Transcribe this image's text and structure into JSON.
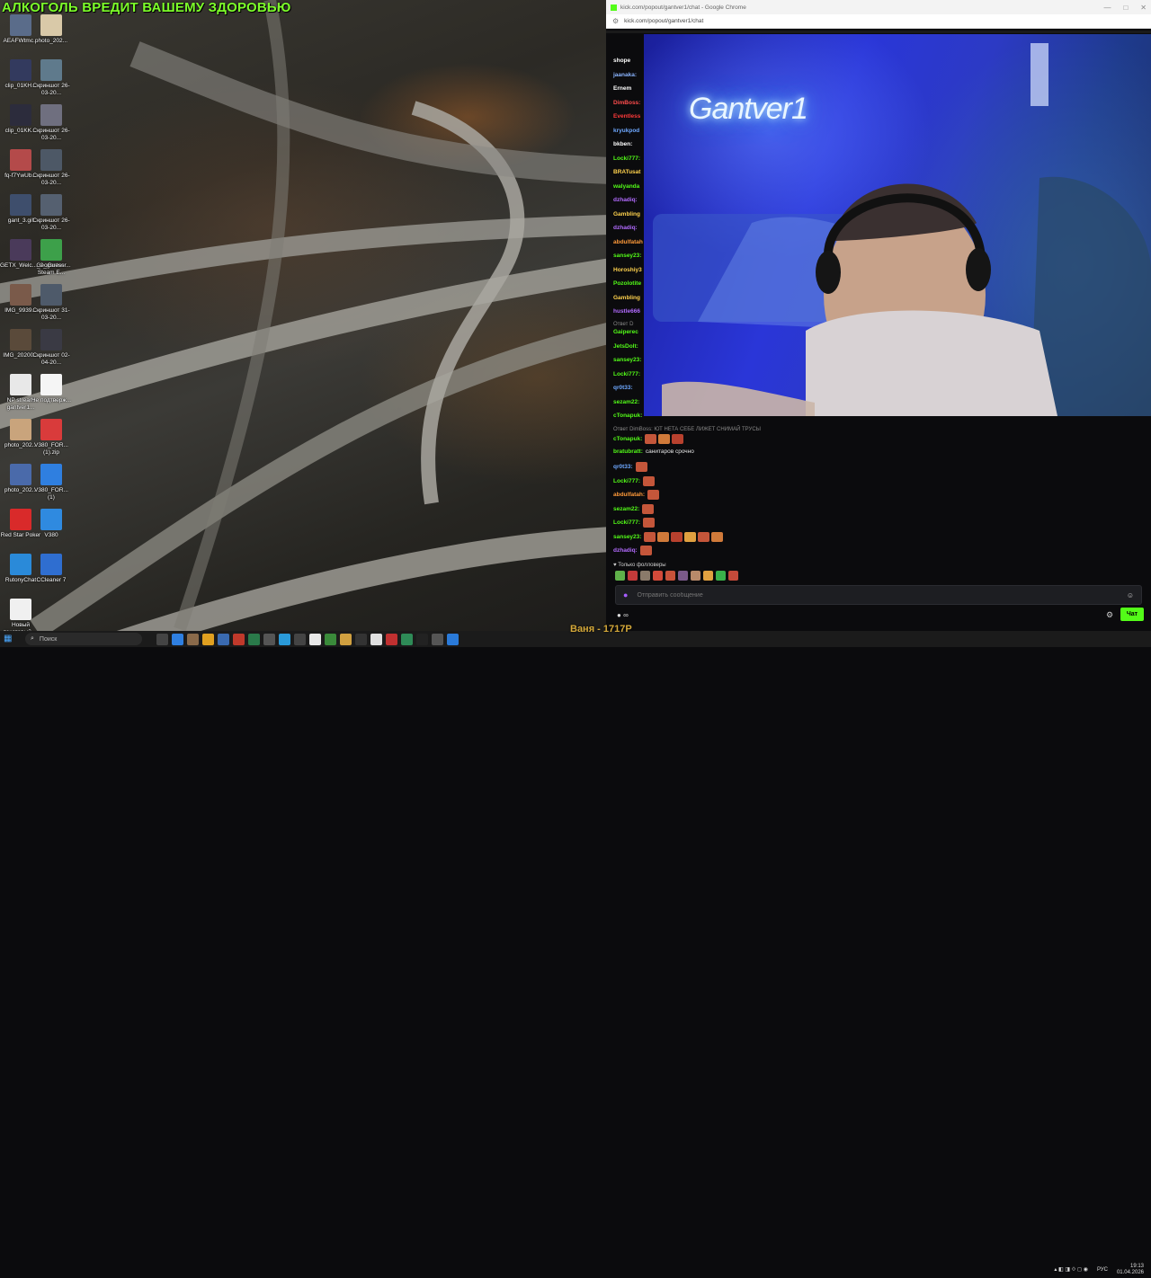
{
  "desktop": {
    "banner": "АЛКОГОЛЬ ВРЕДИТ ВАШЕМУ ЗДОРОВЬЮ",
    "icons": [
      {
        "label": "AEAFWtmc...",
        "color": "#5a6c8a"
      },
      {
        "label": "photo_202...",
        "color": "#d9c9a8"
      },
      {
        "label": "clip_01KH...",
        "color": "#333a5e"
      },
      {
        "label": "Скриншот 26-03-20...",
        "color": "#5f7a8c"
      },
      {
        "label": "clip_01KK...",
        "color": "#2c2c3c"
      },
      {
        "label": "Скриншот 26-03-20...",
        "color": "#6f6f7f"
      },
      {
        "label": "fq-f7YwUb...",
        "color": "#b44a4a"
      },
      {
        "label": "Скриншот 26-03-20...",
        "color": "#4d5866"
      },
      {
        "label": "gant_3.gif",
        "color": "#3e4e6c"
      },
      {
        "label": "Скриншот 26-03-20...",
        "color": "#556070"
      },
      {
        "label": "GETX_Welc..._2_gantver...",
        "color": "#4a3a5a"
      },
      {
        "label": "GeoGuessr Steam E...",
        "color": "#3da04a"
      },
      {
        "label": "IMG_9939...",
        "color": "#7a5a4a"
      },
      {
        "label": "Скриншот 31-03-20...",
        "color": "#4e5a6a"
      },
      {
        "label": "IMG_20200...",
        "color": "#5a4a3a"
      },
      {
        "label": "Скриншот 02-04-20...",
        "color": "#3a3a44"
      },
      {
        "label": "NP stream gantver1...",
        "color": "#e8e8e8"
      },
      {
        "label": "Не подтверж...",
        "color": "#f5f5f5"
      },
      {
        "label": "photo_202...",
        "color": "#c9a47c"
      },
      {
        "label": "V380_FOR... (1).zip",
        "color": "#d93b3b"
      },
      {
        "label": "photo_202...",
        "color": "#4a6aaa"
      },
      {
        "label": "V380_FOR... (1)",
        "color": "#2f7fe0"
      },
      {
        "label": "Red Star Poker",
        "color": "#d92a2a"
      },
      {
        "label": "V380",
        "color": "#2f8ae0"
      },
      {
        "label": "RutonyChat",
        "color": "#2a8ad9"
      },
      {
        "label": "CCleaner 7",
        "color": "#2f6ed0"
      },
      {
        "label": "Новый текстовый ...",
        "color": "#f0f0f0"
      }
    ]
  },
  "browser": {
    "window_title": "kick.com/popout/gantver1/chat - Google Chrome",
    "url": "kick.com/popout/gantver1/chat",
    "controls": [
      "—",
      "□",
      "✕"
    ]
  },
  "stream": {
    "neon_sign": "Gantver1"
  },
  "chat": {
    "top_messages": [
      {
        "user": "shope",
        "color": "#ffffff"
      },
      {
        "user": "jaanaka:",
        "color": "#8ab4ff"
      },
      {
        "user": "Ernem",
        "color": "#ffffff"
      },
      {
        "user": "DimBoss:",
        "color": "#ff4d4d"
      },
      {
        "user": "Eventless",
        "color": "#ff3a3a"
      },
      {
        "user": "kryukpod",
        "color": "#6ea8ff"
      },
      {
        "user": "bkben:",
        "color": "#ffffff"
      },
      {
        "user": "Locki777:",
        "color": "#53fc18"
      },
      {
        "user": "BRATusat",
        "color": "#ffd24d"
      },
      {
        "user": "walyanda",
        "color": "#53fc18"
      },
      {
        "user": "dzhadiq:",
        "color": "#b26bff"
      },
      {
        "user": "Gambling",
        "color": "#ffd24d"
      },
      {
        "user": "dzhadiq:",
        "color": "#b26bff"
      },
      {
        "user": "abdulfatah",
        "color": "#ff9a3a"
      },
      {
        "user": "sansey23:",
        "color": "#53fc18"
      },
      {
        "user": "Horoshiy3",
        "color": "#ffd24d"
      },
      {
        "user": "Pozolotite",
        "color": "#53fc18"
      },
      {
        "user": "Gambling",
        "color": "#ffd24d"
      },
      {
        "user": "hustle666",
        "color": "#b26bff"
      }
    ],
    "reply_label_1": "Ответ D",
    "mid_messages": [
      {
        "user": "Gaiperec",
        "color": "#53fc18"
      },
      {
        "user": "JetsDolt:",
        "color": "#53fc18"
      },
      {
        "user": "sansey23:",
        "color": "#53fc18"
      },
      {
        "user": "Locki777:",
        "color": "#53fc18"
      },
      {
        "user": "qr0t33:",
        "color": "#6ea8ff"
      },
      {
        "user": "sezam22:",
        "color": "#53fc18"
      },
      {
        "user": "cTonapuk:",
        "color": "#53fc18"
      }
    ],
    "reply_label_2": "Ответ DimBoss: ЮТ НЕТА СЕБЕ ЛИЖЕТ СНИМАЙ ТРУСЫ",
    "bottom_messages": [
      {
        "user": "cTonapuk:",
        "color": "#53fc18",
        "text": "",
        "emotes": 3
      },
      {
        "user": "bratubratt:",
        "color": "#53fc18",
        "text": "санитаров срочно",
        "emotes": 0
      },
      {
        "user": "qr0t33:",
        "color": "#6ea8ff",
        "text": "",
        "emotes": 1
      },
      {
        "user": "Locki777:",
        "color": "#53fc18",
        "text": "",
        "emotes": 1
      },
      {
        "user": "abdulfatah:",
        "color": "#ff9a3a",
        "text": "",
        "emotes": 1
      },
      {
        "user": "sezam22:",
        "color": "#53fc18",
        "text": "",
        "emotes": 1
      },
      {
        "user": "Locki777:",
        "color": "#53fc18",
        "text": "",
        "emotes": 1
      },
      {
        "user": "sansey23:",
        "color": "#53fc18",
        "text": "",
        "emotes": 6
      },
      {
        "user": "dzhadiq:",
        "color": "#b26bff",
        "text": "",
        "emotes": 1
      }
    ],
    "followers_only": "Только фолловеры",
    "input_placeholder": "Отправить сообщение",
    "infinity": "∞",
    "send_label": "Чат"
  },
  "taskbar": {
    "search_placeholder": "Поиск",
    "overlay_text": "Ваня - 1717Р",
    "lang": "РУС",
    "time": "19:13",
    "date": "01.04.2026"
  }
}
